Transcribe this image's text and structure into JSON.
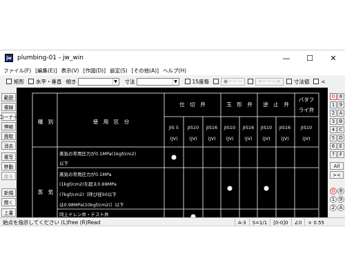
{
  "window": {
    "title": "plumbing-01 - jw_win",
    "app_icon_text": "jw",
    "controls": {
      "minimize": "—",
      "maximize": "☐",
      "close": "✕"
    }
  },
  "menubar": {
    "items": [
      "ファイル(F)",
      "[編集(E)]",
      "表示(V)",
      "[作図(D)]",
      "設定(S)",
      "[その他(A)]",
      "ヘルプ(H)"
    ]
  },
  "toolbar": {
    "rect": "矩形",
    "horizontal_vertical": "水平・垂直",
    "tilt": "傾き",
    "dimension": "寸法",
    "degree15": "15度毎",
    "dim_button_1": "●－－－",
    "dim_button_2": "<－－－>",
    "dimension_value": "寸法値",
    "lt": "<"
  },
  "leftpanel": {
    "items": [
      "範囲",
      "複線",
      "コーナー",
      "伸縮",
      "面取",
      "消去",
      "複写",
      "移動",
      "戻る",
      "新規",
      "開く",
      "上書"
    ]
  },
  "rightpanel": {
    "top": [
      "0",
      "8",
      "1",
      "9",
      "2",
      "A",
      "3",
      "B",
      "4",
      "C",
      "5",
      "D",
      "6",
      "E",
      "7",
      "F"
    ],
    "all": "All",
    "arrows": "><",
    "bottom": [
      "0",
      "8",
      "1",
      "9",
      "2",
      "A"
    ]
  },
  "table": {
    "col_kind": "種　別",
    "col_usage": "使　用　区　分",
    "groups": [
      "仕　切　弁",
      "玉　形　弁",
      "逆　止　弁",
      "バタフ",
      "ライ弁"
    ],
    "sub_std": [
      "JIS 5",
      "JIS10",
      "JIS16",
      "JIS10",
      "JIS16",
      "JIS10",
      "JIS16",
      "JIS10"
    ],
    "sub_jv": [
      "(JV)",
      "(JV)",
      "(JV)",
      "(JV)",
      "(JV)",
      "(JV)",
      "(JV)",
      "(JV)"
    ],
    "kind_steam": "蒸　気",
    "row1_line1": "蒸気の常用圧力が0.1MPa(1kgf/cm2)",
    "row1_line2": "以下",
    "row2_line1": "蒸気の常用圧力が0.1MPa",
    "row2_line2": "(1kgf/cm2)を超え0.69MPa",
    "row2_line3": "(7kgf/cm2)〔呼び径50以下",
    "row2_line4": "は0.98MPa(10kgf/cm2)〕以下",
    "row3_line1": "同上ドレン弁・テスト弁"
  },
  "statusbar": {
    "message": "始点を指示してください (L)free (R)Read",
    "paper": "A-3",
    "scale": "S=1/1",
    "layer": "[0-0]0",
    "angle": "∠0",
    "zoom": "× 0.55"
  }
}
